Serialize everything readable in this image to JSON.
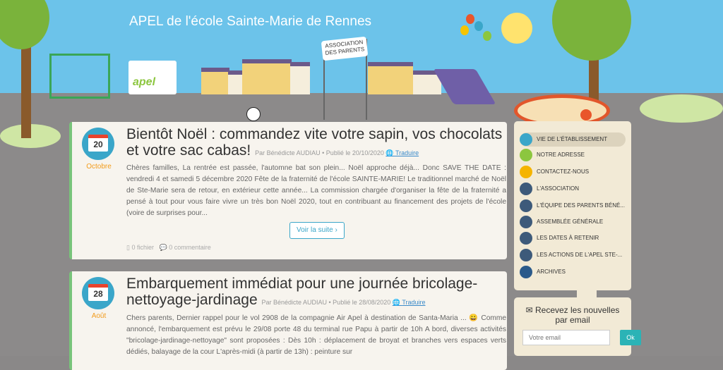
{
  "site": {
    "title": "APEL de l'école Sainte-Marie de Rennes",
    "logo_text": "apel",
    "banner_text": "ASSOCIATION DES PARENTS"
  },
  "articles": [
    {
      "day": "20",
      "month": "Octobre",
      "title": "Bientôt Noël : commandez vite votre sapin, vos chocolats et votre sac cabas!",
      "meta": "Par Bénédicte AUDIAU • Publié le 20/10/2020",
      "translate": "Traduire",
      "body": "Chères familles, La rentrée est passée, l'automne bat son plein... Noël approche déjà... Donc SAVE THE DATE : vendredi 4 et samedi 5 décembre 2020 Fête de la fraternité de l'école SAINTE-MARIE! Le traditionnel marché de Noël de Ste-Marie sera de retour, en extérieur cette année... La commission chargée d'organiser la fête de la fraternité a pensé à tout pour vous faire vivre un très bon Noël 2020, tout en contribuant au financement des projets de l'école (voire de surprises pour...",
      "read_more": "Voir la suite ›",
      "files": "0 fichier",
      "comments": "0 commentaire"
    },
    {
      "day": "28",
      "month": "Août",
      "title": "Embarquement immédiat pour une journée bricolage-nettoyage-jardinage",
      "meta": "Par Bénédicte AUDIAU • Publié le 28/08/2020",
      "translate": "Traduire",
      "body": "Chers parents, Dernier rappel pour le vol 2908 de la compagnie Air Apel à destination de Santa-Maria ... 😀 Comme annoncé, l'embarquement est prévu le 29/08 porte 48 du terminal rue Papu à partir de 10h A bord, diverses activités \"bricolage-jardinage-nettoyage\" sont proposées : Dès 10h : déplacement de broyat et branches vers espaces verts dédiés, balayage de la cour L'après-midi (à partir de 13h) : peinture sur"
    }
  ],
  "sidebar": {
    "items": [
      {
        "label": "VIE DE L'ÉTABLISSEMENT",
        "icon": "school-icon"
      },
      {
        "label": "NOTRE ADRESSE",
        "icon": "map-pin-icon"
      },
      {
        "label": "CONTACTEZ-NOUS",
        "icon": "envelope-icon"
      },
      {
        "label": "L'ASSOCIATION",
        "icon": "document-icon"
      },
      {
        "label": "L'ÉQUIPE DES PARENTS BÉNÉ...",
        "icon": "document-icon"
      },
      {
        "label": "ASSEMBLÉE GÉNÉRALE",
        "icon": "document-icon"
      },
      {
        "label": "LES DATES À RETENIR",
        "icon": "document-icon"
      },
      {
        "label": "LES ACTIONS DE L'APEL STE-...",
        "icon": "folder-icon"
      },
      {
        "label": "ARCHIVES",
        "icon": "archive-icon"
      }
    ]
  },
  "newsletter": {
    "title": "✉ Recevez les nouvelles par email",
    "placeholder": "Votre email",
    "button": "Ok"
  }
}
